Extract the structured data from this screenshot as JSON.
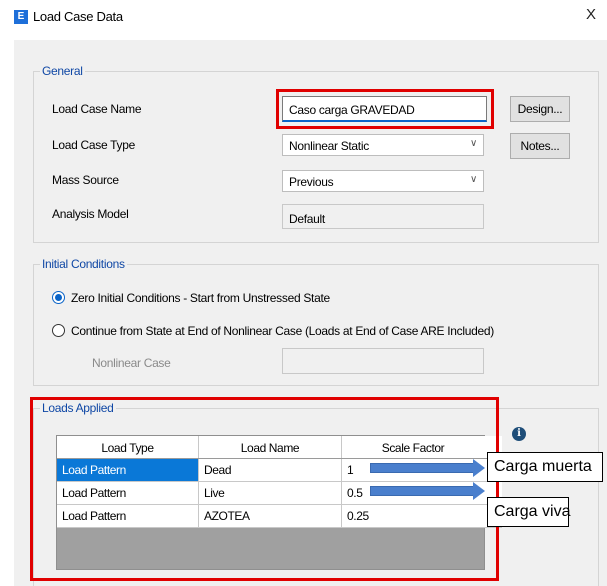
{
  "window": {
    "title": "Load Case Data",
    "app_icon_letter": "E",
    "close_glyph": "X"
  },
  "general": {
    "group_label": "General",
    "load_case_name_label": "Load Case Name",
    "load_case_name_value": "Caso carga  GRAVEDAD",
    "load_case_type_label": "Load Case Type",
    "load_case_type_value": "Nonlinear Static",
    "mass_source_label": "Mass Source",
    "mass_source_value": "Previous",
    "analysis_model_label": "Analysis Model",
    "analysis_model_value": "Default",
    "design_button": "Design...",
    "notes_button": "Notes..."
  },
  "initial_conditions": {
    "group_label": "Initial Conditions",
    "option_zero": "Zero Initial Conditions - Start from Unstressed State",
    "option_continue": "Continue from State at End of Nonlinear Case  (Loads at End of Case ARE Included)",
    "nonlinear_case_label": "Nonlinear Case",
    "nonlinear_case_value": "",
    "selected_option": "zero"
  },
  "loads_applied": {
    "group_label": "Loads Applied",
    "columns": [
      "Load Type",
      "Load Name",
      "Scale Factor"
    ],
    "rows": [
      {
        "type": "Load Pattern",
        "name": "Dead",
        "factor": "1"
      },
      {
        "type": "Load Pattern",
        "name": "Live",
        "factor": "0.5"
      },
      {
        "type": "Load Pattern",
        "name": "AZOTEA",
        "factor": "0.25"
      }
    ]
  },
  "annotations": {
    "callout_dead": "Carga muerta",
    "callout_live": "Carga viva",
    "highlight_color": "#e00000",
    "arrow_color": "#4a7fcd"
  },
  "icons": {
    "info": "info-icon",
    "chevron": "chevron-down-icon"
  }
}
